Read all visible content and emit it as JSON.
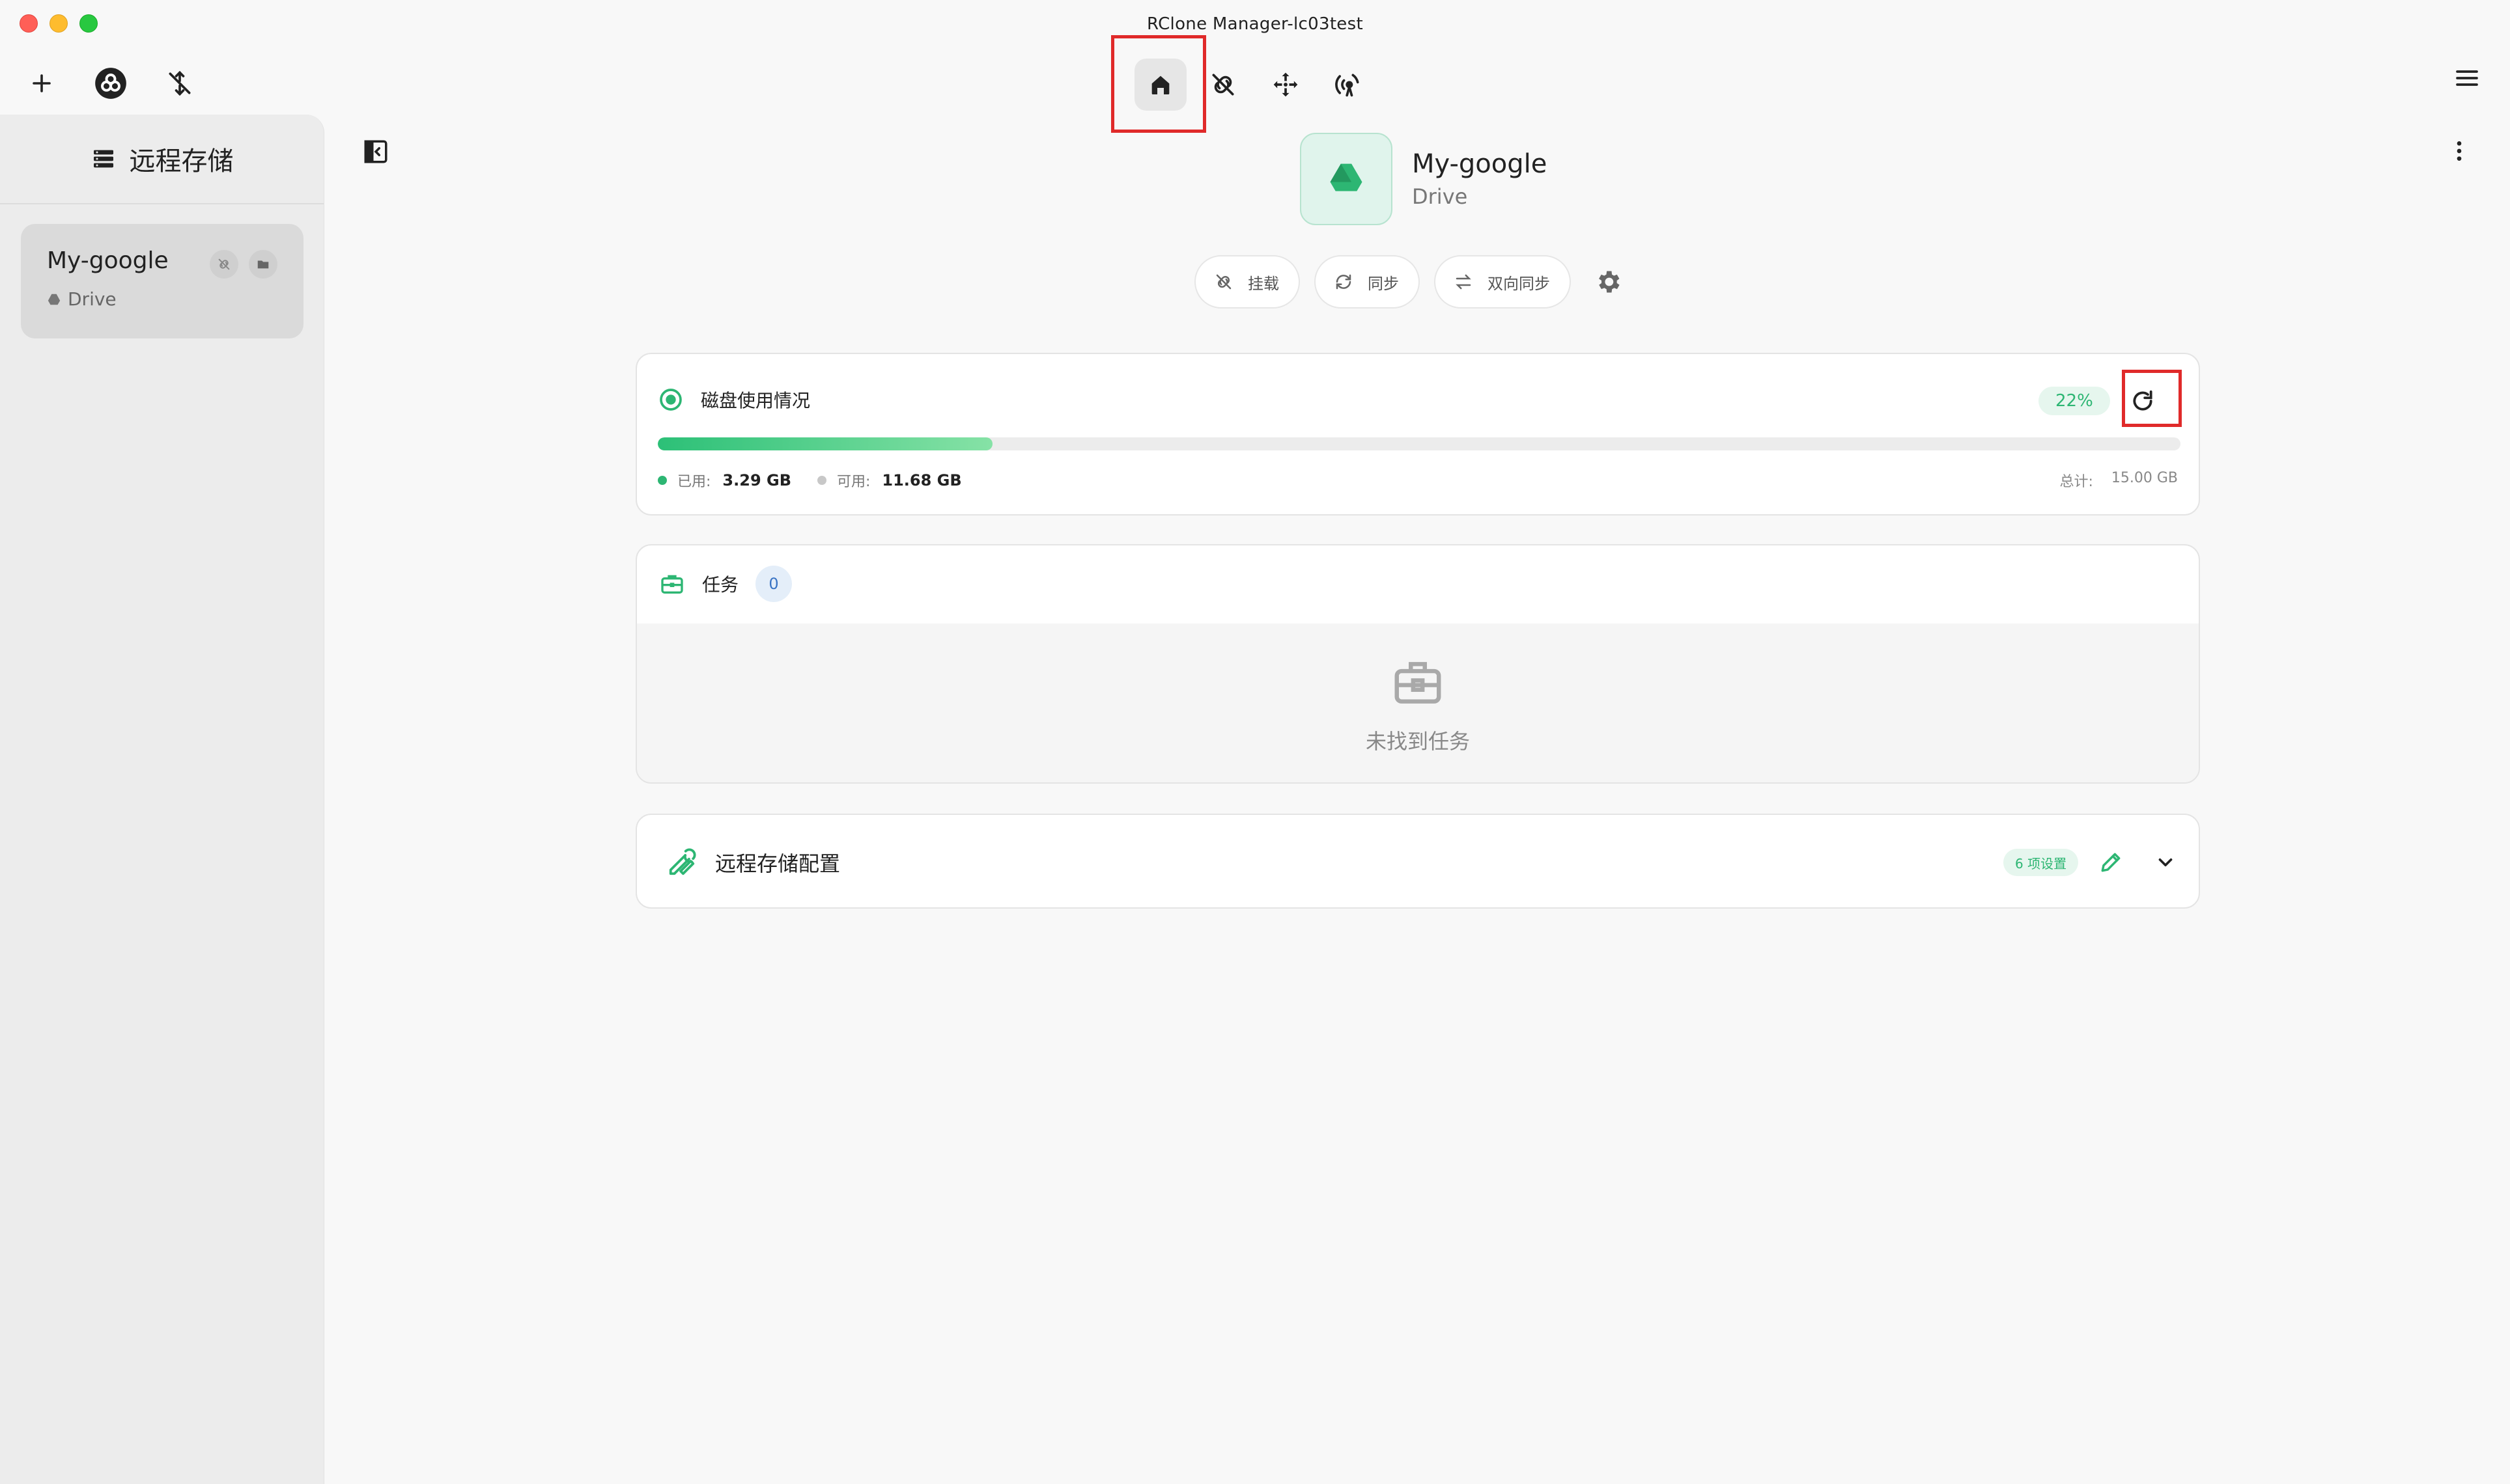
{
  "window": {
    "title": "RClone Manager-lc03test"
  },
  "toolbar": {
    "left": [
      {
        "icon": "plus-icon"
      },
      {
        "icon": "rclone-logo-icon"
      },
      {
        "icon": "disconnect-icon"
      }
    ],
    "nav": [
      {
        "icon": "home-icon",
        "active": true
      },
      {
        "icon": "mount-icon"
      },
      {
        "icon": "move-icon"
      },
      {
        "icon": "serve-icon"
      }
    ],
    "menu_icon": "hamburger-menu-icon"
  },
  "sidebar": {
    "header": "远程存储",
    "remotes": [
      {
        "name": "My-google",
        "type": "Drive"
      }
    ]
  },
  "remote": {
    "name": "My-google",
    "type": "Drive",
    "actions": [
      {
        "label": "挂载",
        "icon": "mount-icon"
      },
      {
        "label": "同步",
        "icon": "sync-icon"
      },
      {
        "label": "双向同步",
        "icon": "bisync-icon"
      }
    ]
  },
  "disk": {
    "title": "磁盘使用情况",
    "percent_label": "22%",
    "percent": 22,
    "used_label": "已用:",
    "used_value": "3.29 GB",
    "free_label": "可用:",
    "free_value": "11.68 GB",
    "total_label": "总计:",
    "total_value": "15.00 GB"
  },
  "tasks": {
    "title": "任务",
    "count": "0",
    "empty_message": "未找到任务"
  },
  "config": {
    "title": "远程存储配置",
    "badge": "6 项设置"
  },
  "colors": {
    "accent": "#2db673",
    "highlight": "#e02a2a",
    "sidebar_bg": "#ececec"
  }
}
